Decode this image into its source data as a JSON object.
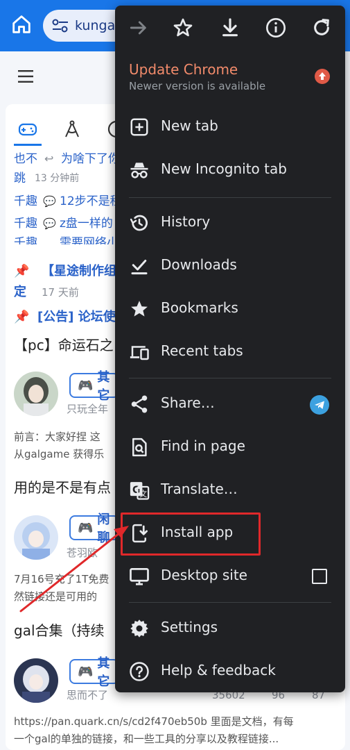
{
  "browser": {
    "url": "kungal",
    "accent": "#1976e8"
  },
  "forum": {
    "feed": [
      {
        "user": "也不",
        "text": "为啥下了你"
      },
      {
        "user": "跳",
        "time": "13 分钟前"
      },
      {
        "user": "千趣",
        "text": "12步不是租"
      },
      {
        "user": "千趣",
        "text": "z盘一样的"
      },
      {
        "user": "千趣",
        "text": "需要网络小"
      }
    ],
    "pinned": [
      {
        "title": "【星途制作组",
        "title2": "定",
        "time": "17 天前"
      },
      {
        "title": "[公告] 论坛使"
      }
    ],
    "posts": [
      {
        "heading": "【pc】命运石之",
        "chip": "其它",
        "author": "只玩全年",
        "excerpt1": "前言：大家好捏 这",
        "excerpt2": "从galgame 获得乐"
      },
      {
        "heading": "用的是不是有点",
        "chip": "闲聊",
        "author": "苍羽欧",
        "excerpt1": "7月16号充了1T免费",
        "excerpt2": "然链接还是可用的"
      },
      {
        "heading": "gal合集（持续",
        "chip": "其它",
        "author": "思而不了",
        "views": "35602",
        "likes": "96",
        "replies": "87",
        "excerpt1": "https://pan.quark.cn/s/cd2f470eb50b 里面是文档，有每",
        "excerpt2": "一个gal的单独的链接，和一些工具的分享以及教程链接..."
      }
    ]
  },
  "menu": {
    "top_icons": [
      "forward-icon",
      "star-icon",
      "download-icon",
      "info-icon",
      "refresh-icon"
    ],
    "update": {
      "title": "Update Chrome",
      "subtitle": "Newer version is available"
    },
    "items": {
      "new_tab": "New tab",
      "incognito": "New Incognito tab",
      "history": "History",
      "downloads": "Downloads",
      "bookmarks": "Bookmarks",
      "recent_tabs": "Recent tabs",
      "share": "Share…",
      "find": "Find in page",
      "translate": "Translate…",
      "install": "Install app",
      "desktop": "Desktop site",
      "settings": "Settings",
      "help": "Help & feedback"
    },
    "highlight_color": "#e0282a"
  }
}
